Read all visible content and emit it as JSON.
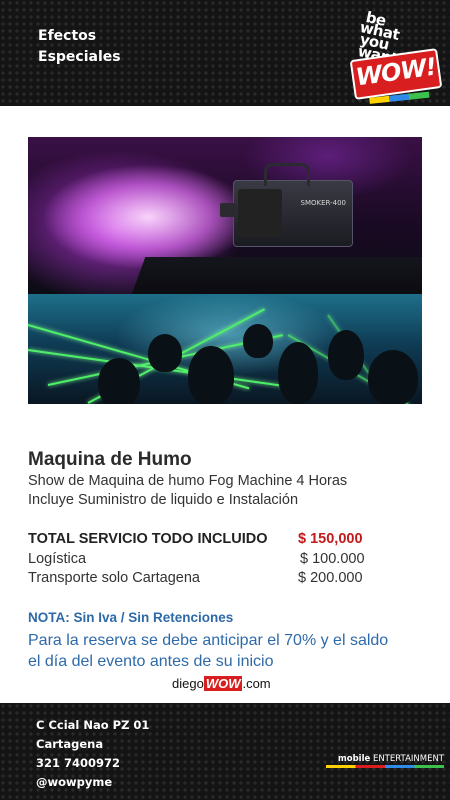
{
  "header": {
    "title_line1": "Efectos",
    "title_line2": "Especiales",
    "brand_line1": "be",
    "brand_line2": "what",
    "brand_line3": "you",
    "brand_line4": "want",
    "brand_logo": "WOW!"
  },
  "photos": {
    "top": {
      "icon": "fog-machine-image",
      "machine_label": "SMOKER-400"
    },
    "bottom": {
      "icon": "laser-party-image"
    }
  },
  "service": {
    "title": "Maquina de Humo",
    "description_line1": "Show de Maquina de humo Fog Machine 4 Horas",
    "description_line2": "Incluye Suministro de liquido e Instalación"
  },
  "pricing": {
    "total_label": "TOTAL SERVICIO TODO INCLUIDO",
    "total_value": "$ 150,000",
    "logistics_label": "Logística",
    "logistics_value": "$ 100.000",
    "transport_label": "Transporte solo Cartagena",
    "transport_value": "$ 200.000"
  },
  "note": "NOTA: Sin Iva / Sin Retenciones",
  "reserve_line1": "Para la reserva se debe anticipar el 70% y el saldo",
  "reserve_line2": "el día del evento antes de su inicio",
  "site": {
    "prefix": "diego",
    "wow": "WOW",
    "suffix": ".com"
  },
  "footer": {
    "address": "C Ccial Nao PZ 01",
    "city": "Cartagena",
    "phone": "321 7400972",
    "handle": "@wowpyme",
    "partner_bold": "mobile",
    "partner_rest": "ENTERTAINMENT"
  },
  "colors": {
    "accent_red": "#c21b1b",
    "note_blue": "#2e6aa8",
    "header_bg": "#141414"
  }
}
